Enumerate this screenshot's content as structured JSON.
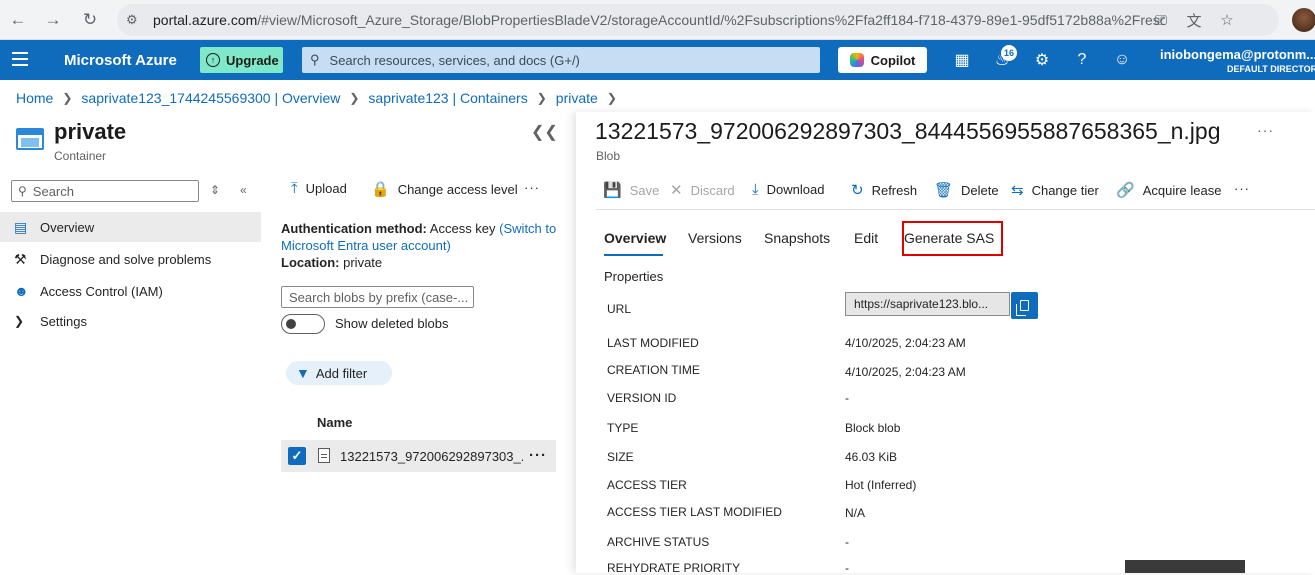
{
  "browser": {
    "url_host": "portal.azure.com",
    "url_rest": "/#view/Microsoft_Azure_Storage/BlobPropertiesBladeV2/storageAccountId/%2Fsubscriptions%2Ffa2ff184-f718-4379-89e1-95df5172b88a%2Freso..."
  },
  "topbar": {
    "brand": "Microsoft Azure",
    "upgrade_label": "Upgrade",
    "search_placeholder": "Search resources, services, and docs (G+/)",
    "copilot_label": "Copilot",
    "notifications_count": "16",
    "user_email": "iniobongema@protonm...",
    "user_directory": "DEFAULT DIRECTOR"
  },
  "breadcrumb": [
    "Home",
    "saprivate123_1744245569300 | Overview",
    "saprivate123 | Containers",
    "private"
  ],
  "resource": {
    "title": "private",
    "subtitle": "Container",
    "search_placeholder": "Search",
    "menu": [
      {
        "label": "Overview",
        "icon": "container-icon",
        "selected": true
      },
      {
        "label": "Diagnose and solve problems",
        "icon": "wrench-icon",
        "selected": false
      },
      {
        "label": "Access Control (IAM)",
        "icon": "people-icon",
        "selected": false
      },
      {
        "label": "Settings",
        "icon": "chevron-right-icon",
        "selected": false
      }
    ]
  },
  "container_pane": {
    "toolbar": {
      "upload": "Upload",
      "change_access": "Change access level"
    },
    "auth_label": "Authentication method:",
    "auth_value": "Access key",
    "auth_link": "(Switch to Microsoft Entra user account)",
    "location_label": "Location:",
    "location_value": "private",
    "blob_search_placeholder": "Search blobs by prefix (case-...",
    "show_deleted_label": "Show deleted blobs",
    "add_filter_label": "Add filter",
    "column_name": "Name",
    "rows": [
      {
        "name": "13221573_972006292897303_..."
      }
    ]
  },
  "blob": {
    "title": "13221573_972006292897303_8444556955887658365_n.jpg",
    "subtitle": "Blob",
    "commands": {
      "save": "Save",
      "discard": "Discard",
      "download": "Download",
      "refresh": "Refresh",
      "delete": "Delete",
      "change_tier": "Change tier",
      "acquire_lease": "Acquire lease"
    },
    "tabs": [
      "Overview",
      "Versions",
      "Snapshots",
      "Edit",
      "Generate SAS"
    ],
    "properties_heading": "Properties",
    "url_value": "https://saprivate123.blo...",
    "properties": [
      {
        "key": "URL",
        "value": ""
      },
      {
        "key": "LAST MODIFIED",
        "value": "4/10/2025, 2:04:23 AM"
      },
      {
        "key": "CREATION TIME",
        "value": "4/10/2025, 2:04:23 AM"
      },
      {
        "key": "VERSION ID",
        "value": "-"
      },
      {
        "key": "TYPE",
        "value": "Block blob"
      },
      {
        "key": "SIZE",
        "value": "46.03 KiB"
      },
      {
        "key": "ACCESS TIER",
        "value": "Hot (Inferred)"
      },
      {
        "key": "ACCESS TIER LAST MODIFIED",
        "value": "N/A"
      },
      {
        "key": "ARCHIVE STATUS",
        "value": "-"
      },
      {
        "key": "REHYDRATE PRIORITY",
        "value": "-"
      }
    ]
  },
  "colors": {
    "azure_blue": "#0f6cbd",
    "highlight_red": "#e00000",
    "upgrade_green": "#7ee8c8"
  }
}
